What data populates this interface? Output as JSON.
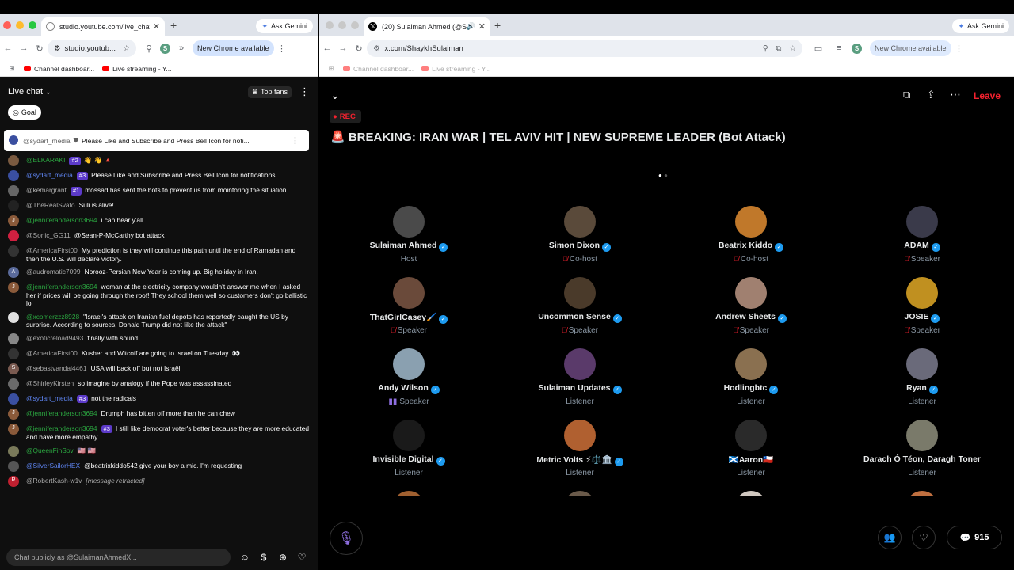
{
  "left": {
    "tab_title": "studio.youtube.com/live_chat",
    "new_tab": "+",
    "ask_gemini": "Ask Gemini",
    "url": "studio.youtub...",
    "profile_letter": "S",
    "new_chrome": "New Chrome available",
    "bookmarks": [
      "Channel dashboar...",
      "Live streaming - Y..."
    ],
    "chat_title": "Live chat",
    "top_fans": "Top fans",
    "goal": "Goal",
    "pinned_author": "@sydart_media",
    "pinned_text": "Please Like and Subscribe and Press Bell Icon for noti...",
    "messages": [
      {
        "author": "@ELKARAKI",
        "badge": "#2",
        "text": "👋 👋 🔺",
        "color": "g",
        "av": "#7a5a40"
      },
      {
        "author": "@sydart_media",
        "badge": "#3",
        "text": "Please Like and Subscribe and Press Bell Icon for notifications",
        "color": "b",
        "av": "#3a4fa0"
      },
      {
        "author": "@kemargrant",
        "badge": "#1",
        "text": "mossad has sent the bots to prevent us from mointoring the situation",
        "color": "n",
        "av": "#666"
      },
      {
        "author": "@TheRealSvato",
        "badge": "",
        "text": "Suli is alive!",
        "color": "n",
        "av": "#222"
      },
      {
        "author": "@jenniferanderson3694",
        "badge": "",
        "text": "i can hear y'all",
        "color": "g",
        "av": "#8a5a3a",
        "letter": "J"
      },
      {
        "author": "@Sonic_GG11",
        "badge": "",
        "text": "@Sean-P-McCarthy bot attack",
        "color": "n",
        "av": "#d02040"
      },
      {
        "author": "@AmericaFirst00",
        "badge": "",
        "text": "My prediction is they will continue this path until the end of Ramadan and then the U.S. will declare victory.",
        "color": "n",
        "av": "#333"
      },
      {
        "author": "@audromatic7099",
        "badge": "",
        "text": "Norooz-Persian New Year is coming up. Big holiday in Iran.",
        "color": "n",
        "av": "#5a6a9a",
        "letter": "A"
      },
      {
        "author": "@jenniferanderson3694",
        "badge": "",
        "text": "woman at the electricity company wouldn't answer me when I asked her if prices will be going through the roof! They school them well so customers don't go ballistic lol",
        "color": "g",
        "av": "#8a5a3a",
        "letter": "J"
      },
      {
        "author": "@xcomerzzz8928",
        "badge": "",
        "text": "\"Israel's attack on Iranian fuel depots has reportedly caught the US by surprise. According to sources, Donald Trump did not like the attack\"",
        "color": "g",
        "av": "#e0e0e0"
      },
      {
        "author": "@exoticreload9493",
        "badge": "",
        "text": "finally with sound",
        "color": "n",
        "av": "#888"
      },
      {
        "author": "@AmericaFirst00",
        "badge": "",
        "text": "Kusher and Witcoff are going to Israel on Tuesday. 👀",
        "color": "n",
        "av": "#333"
      },
      {
        "author": "@sebastvandal4461",
        "badge": "",
        "text": "USA will back off but not Israël",
        "color": "n",
        "av": "#7a5a50",
        "letter": "S"
      },
      {
        "author": "@ShirleyKirsten",
        "badge": "",
        "text": "so imagine by analogy if the Pope was assassinated",
        "color": "n",
        "av": "#6a6a6a"
      },
      {
        "author": "@sydart_media",
        "badge": "#3",
        "text": "not the radicals",
        "color": "b",
        "av": "#3a4fa0"
      },
      {
        "author": "@jenniferanderson3694",
        "badge": "",
        "text": "Drumph has bitten off more than he can chew",
        "color": "g",
        "av": "#8a5a3a",
        "letter": "J"
      },
      {
        "author": "@jenniferanderson3694",
        "badge": "#3",
        "text": "I still like democrat voter's better because they are more educated and have more empathy",
        "color": "g",
        "av": "#8a5a3a",
        "letter": "J"
      },
      {
        "author": "@QueenFinSov",
        "badge": "",
        "text": "🇺🇸 🇺🇸",
        "color": "g",
        "av": "#7a7a5a"
      },
      {
        "author": "@SilverSailorHEX",
        "badge": "",
        "text": "@beatrixkiddo542 give your boy a mic. I'm requesting",
        "color": "b",
        "av": "#555"
      },
      {
        "author": "@RobertKash-w1v",
        "badge": "",
        "text": "[message retracted]",
        "color": "n",
        "av": "#c02030",
        "letter": "R",
        "retracted": true
      }
    ],
    "chat_input_placeholder": "Chat publicly as @SulaimanAhmedX..."
  },
  "right": {
    "tab_title": "(20) Sulaiman Ahmed (@S",
    "new_tab": "+",
    "ask_gemini": "Ask Gemini",
    "url": "x.com/ShaykhSulaiman",
    "profile_letter": "S",
    "new_chrome": "New Chrome available",
    "bookmarks": [
      "Channel dashboar...",
      "Live streaming - Y..."
    ],
    "leave": "Leave",
    "rec": "REC",
    "title": "🚨 BREAKING: IRAN WAR | TEL AVIV HIT | NEW SUPREME LEADER (Bot Attack)",
    "participants": [
      {
        "name": "Sulaiman Ahmed",
        "verified": true,
        "role": "Host",
        "muted": false,
        "color": "#4a4a4a"
      },
      {
        "name": "Simon Dixon",
        "verified": true,
        "role": "Co-host",
        "muted": true,
        "color": "#5a4a3a"
      },
      {
        "name": "Beatrix Kiddo",
        "verified": true,
        "role": "Co-host",
        "muted": true,
        "color": "#c0782a"
      },
      {
        "name": "ADAM",
        "verified": true,
        "role": "Speaker",
        "muted": true,
        "color": "#3a3a4a"
      },
      {
        "name": "ThatGirlCasey🖌️",
        "verified": true,
        "role": "Speaker",
        "muted": true,
        "color": "#6a4a3a"
      },
      {
        "name": "Uncommon Sense",
        "verified": true,
        "role": "Speaker",
        "muted": true,
        "color": "#4a3a2a"
      },
      {
        "name": "Andrew Sheets",
        "verified": true,
        "role": "Speaker",
        "muted": true,
        "color": "#a08070"
      },
      {
        "name": "JOSIE",
        "verified": true,
        "role": "Speaker",
        "muted": true,
        "color": "#c09020"
      },
      {
        "name": "Andy Wilson",
        "verified": true,
        "role": "Speaker",
        "muted": false,
        "speaking": true,
        "color": "#8aa0b0"
      },
      {
        "name": "Sulaiman Updates",
        "verified": true,
        "role": "Listener",
        "muted": false,
        "color": "#5a3a6a"
      },
      {
        "name": "Hodlingbtc",
        "verified": true,
        "role": "Listener",
        "muted": false,
        "color": "#8a7050"
      },
      {
        "name": "Ryan",
        "verified": true,
        "role": "Listener",
        "muted": false,
        "color": "#6a6a7a"
      },
      {
        "name": "Invisible Digital",
        "verified": true,
        "role": "Listener",
        "muted": false,
        "color": "#1a1a1a"
      },
      {
        "name": "Metric Volts ⚡⚖️🏛️",
        "verified": true,
        "role": "Listener",
        "muted": false,
        "color": "#b06030"
      },
      {
        "name": "🏴󠁧󠁢󠁳󠁣󠁴󠁿Aaron🇨🇱",
        "verified": false,
        "role": "Listener",
        "muted": false,
        "color": "#2a2a2a"
      },
      {
        "name": "Darach Ó Téon, Daragh Toner",
        "verified": false,
        "role": "Listener",
        "muted": false,
        "color": "#7a7a6a"
      },
      {
        "name": "",
        "verified": false,
        "role": "",
        "muted": false,
        "color": "#a06030"
      },
      {
        "name": "",
        "verified": false,
        "role": "",
        "muted": false,
        "color": "#6a5a4a"
      },
      {
        "name": "",
        "verified": false,
        "role": "",
        "muted": false,
        "color": "#d0c8c0"
      },
      {
        "name": "",
        "verified": false,
        "role": "",
        "muted": false,
        "color": "#c07040"
      }
    ],
    "listener_count": "915"
  },
  "colors": {
    "accent_red": "#f4212e",
    "x_blue": "#1d9bf0",
    "yt_green": "#2ba640"
  }
}
